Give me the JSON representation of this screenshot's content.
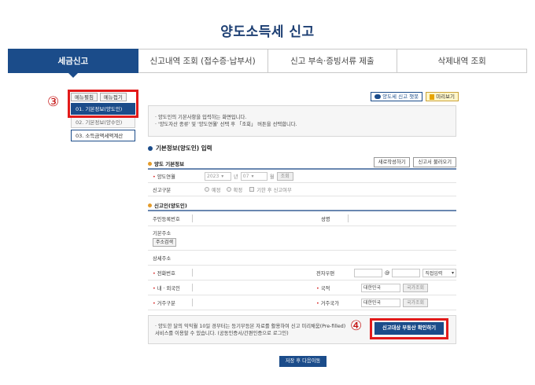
{
  "page_title": "양도소득세 신고",
  "tabs": [
    {
      "label": "세금신고",
      "active": true
    },
    {
      "label": "신고내역 조회 (접수증·납부서)"
    },
    {
      "label": "신고 부속·증빙서류 제출"
    },
    {
      "label": "삭제내역 조회"
    }
  ],
  "menu_toggle": {
    "open": "메뉴펼침",
    "close": "메뉴접기"
  },
  "side_menu": [
    {
      "label": "01. 기본정보(양도인)",
      "state": "active"
    },
    {
      "label": "02. 기본정보(양수인)",
      "state": "normal"
    },
    {
      "label": "03. 소득금액세액계산",
      "state": "white"
    }
  ],
  "annotations": {
    "step3": "③",
    "step4": "④"
  },
  "top_buttons": {
    "chatbot": "양도세 신고 챗봇",
    "preview": "미리보기"
  },
  "info_lines": [
    "· 양도인의 기본사항을 입력하는 화면입니다.",
    "· '양도자산 종류' 및 '양도연월' 선택 후 「조회」 버튼을 선택합니다."
  ],
  "section_title": "기본정보(양도인) 입력",
  "sub1": {
    "title": "양도 기본정보",
    "new_button": "새로작성하기",
    "load_button": "신고서 불러오기",
    "rows": {
      "transfer_month": {
        "label": "양도연월",
        "year": "2023",
        "year_unit": "년",
        "month": "07",
        "month_unit": "월",
        "query": "조회"
      },
      "report_type": {
        "label": "신고구분",
        "opt1": "예정",
        "opt2": "확정",
        "check": "기한 후 신고여부"
      }
    }
  },
  "sub2": {
    "title": "신고인(양도인)",
    "rrn": "주민등록번호",
    "name": "성명",
    "base_addr": "기본주소",
    "addr_search": "주소검색",
    "detail_addr": "상세주소",
    "phone": "전화번호",
    "email": "전자우편",
    "email_at": "@",
    "email_domain": "직접입력",
    "domestic": "내 · 외국인",
    "nationality": "국적",
    "nationality_val": "대한민국",
    "country_lookup": "국가조회",
    "resident_type": "거주구분",
    "resident_country": "거주국가",
    "resident_country_val": "대한민국"
  },
  "notice_lines": [
    "· 양도한 달의 익익월 10일 경부터는 등기부등본 자료를 활용하여 신고 미리채움(Pre-filled)",
    "  서비스를 이용할 수 있습니다. (공동인증서/간편인증으로 로그인)"
  ],
  "prefill_button": "신고대상 부동산 확인하기",
  "save_button": "저장 후 다음이동",
  "colors": {
    "primary": "#1b4c8a",
    "highlight": "#e21a1a"
  }
}
